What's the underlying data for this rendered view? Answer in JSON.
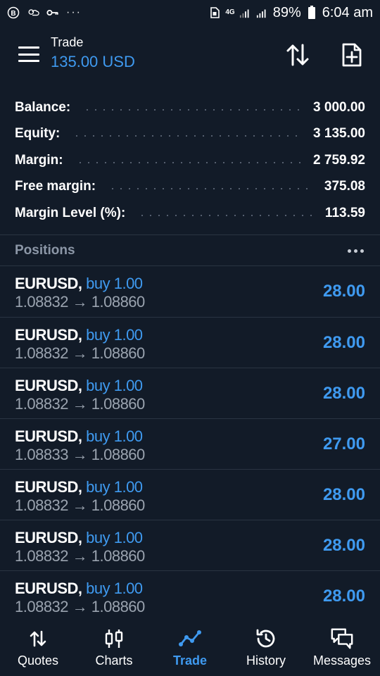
{
  "status_bar": {
    "battery": "89%",
    "time": "6:04 am",
    "network": "4G",
    "dots": "···"
  },
  "header": {
    "title": "Trade",
    "subtitle": "135.00 USD"
  },
  "summary": [
    {
      "label": "Balance:",
      "value": "3 000.00"
    },
    {
      "label": "Equity:",
      "value": "3 135.00"
    },
    {
      "label": "Margin:",
      "value": "2 759.92"
    },
    {
      "label": "Free margin:",
      "value": "375.08"
    },
    {
      "label": "Margin Level (%):",
      "value": "113.59"
    }
  ],
  "positions": {
    "title": "Positions",
    "items": [
      {
        "symbol": "EURUSD,",
        "side": "buy 1.00",
        "prices": "1.08832 → 1.08860",
        "profit": "28.00"
      },
      {
        "symbol": "EURUSD,",
        "side": "buy 1.00",
        "prices": "1.08832 → 1.08860",
        "profit": "28.00"
      },
      {
        "symbol": "EURUSD,",
        "side": "buy 1.00",
        "prices": "1.08832 → 1.08860",
        "profit": "28.00"
      },
      {
        "symbol": "EURUSD,",
        "side": "buy 1.00",
        "prices": "1.08833 → 1.08860",
        "profit": "27.00"
      },
      {
        "symbol": "EURUSD,",
        "side": "buy 1.00",
        "prices": "1.08832 → 1.08860",
        "profit": "28.00"
      },
      {
        "symbol": "EURUSD,",
        "side": "buy 1.00",
        "prices": "1.08832 → 1.08860",
        "profit": "28.00"
      },
      {
        "symbol": "EURUSD,",
        "side": "buy 1.00",
        "prices": "1.08832 → 1.08860",
        "profit": "28.00"
      }
    ]
  },
  "nav": [
    {
      "label": "Quotes",
      "icon": "quotes-arrows-icon",
      "active": false
    },
    {
      "label": "Charts",
      "icon": "candlestick-icon",
      "active": false
    },
    {
      "label": "Trade",
      "icon": "trend-line-icon",
      "active": true
    },
    {
      "label": "History",
      "icon": "history-clock-icon",
      "active": false
    },
    {
      "label": "Messages",
      "icon": "chat-bubbles-icon",
      "active": false
    }
  ],
  "colors": {
    "background": "#121b28",
    "accent": "#3f9af0",
    "muted": "#9aa3af",
    "divider": "#2a3442"
  }
}
